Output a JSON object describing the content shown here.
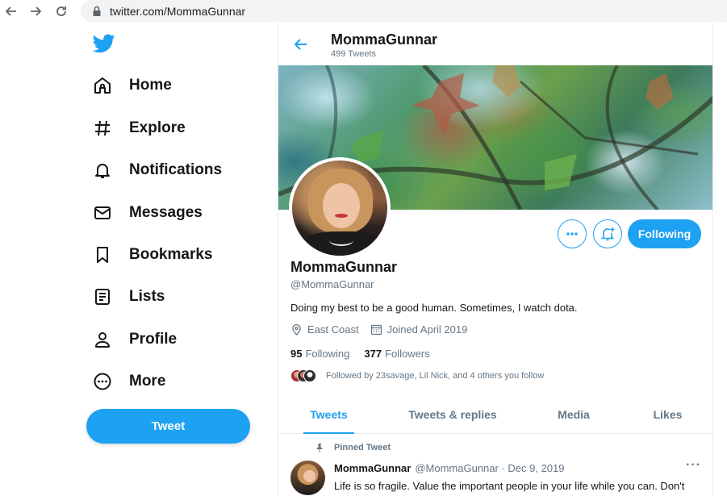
{
  "browser": {
    "url": "twitter.com/MommaGunnar"
  },
  "sidebar": {
    "items": [
      {
        "label": "Home",
        "icon": "home-icon"
      },
      {
        "label": "Explore",
        "icon": "hashtag-icon"
      },
      {
        "label": "Notifications",
        "icon": "bell-icon"
      },
      {
        "label": "Messages",
        "icon": "envelope-icon"
      },
      {
        "label": "Bookmarks",
        "icon": "bookmark-icon"
      },
      {
        "label": "Lists",
        "icon": "list-icon"
      },
      {
        "label": "Profile",
        "icon": "person-icon"
      },
      {
        "label": "More",
        "icon": "more-circle-icon"
      }
    ],
    "tweet_label": "Tweet"
  },
  "header": {
    "name": "MommaGunnar",
    "tweet_count": "499 Tweets"
  },
  "profile": {
    "name": "MommaGunnar",
    "handle": "@MommaGunnar",
    "bio": "Doing my best to be a good human. Sometimes, I watch dota.",
    "location": "East Coast",
    "joined": "Joined April 2019",
    "following_count": "95",
    "following_label": "Following",
    "followers_count": "377",
    "followers_label": "Followers",
    "followed_by": "Followed by 23savage, Lil Nick, and 4 others you follow",
    "follow_button": "Following"
  },
  "tabs": [
    {
      "label": "Tweets",
      "active": true
    },
    {
      "label": "Tweets & replies",
      "active": false
    },
    {
      "label": "Media",
      "active": false
    },
    {
      "label": "Likes",
      "active": false
    }
  ],
  "pinned_tweet": {
    "pinned_label": "Pinned Tweet",
    "author": "MommaGunnar",
    "handle_date": "@MommaGunnar · Dec 9, 2019",
    "text": "Life is so fragile. Value the important people in your life while you can. Don't"
  },
  "colors": {
    "accent": "#1da1f2",
    "text": "#14171a",
    "muted": "#657786"
  }
}
